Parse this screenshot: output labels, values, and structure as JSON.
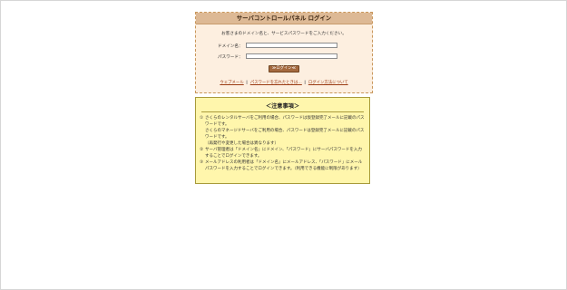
{
  "login": {
    "title": "サーバコントロールパネル ログイン",
    "intro": "お客さまのドメイン名と、サービスパスワードをご入力ください。",
    "domain_label": "ドメイン名：",
    "password_label": "パスワード：",
    "domain_value": "",
    "password_value": "",
    "submit_label": "≫ログイン≪",
    "links": {
      "webmail": "ウェブメール",
      "forgot": "パスワードを忘れたときは…",
      "howto": "ログイン方法について",
      "sep": "‖"
    }
  },
  "notice": {
    "title": "＜注意事項＞",
    "items": [
      {
        "num": "①",
        "text": "さくらのレンタルサーバをご利用の場合、パスワードは仮登録完了メールに記載のパスワードです。\nさくらのマネージドサーバをご利用の場合、パスワードは登録完了メールに記載のパスワードです。\n（再発行や変更した場合は異なります）"
      },
      {
        "num": "②",
        "text": "サーバ管理者は「ドメイン名」にドメイン、「パスワード」にサーバパスワードを入力することでログインできます。"
      },
      {
        "num": "③",
        "text": "メールアドレスの利用者は「ドメイン名」にメールアドレス、「パスワード」にメールパスワードを入力することでログインできます。（利用できる機能に制限があります）"
      }
    ]
  }
}
